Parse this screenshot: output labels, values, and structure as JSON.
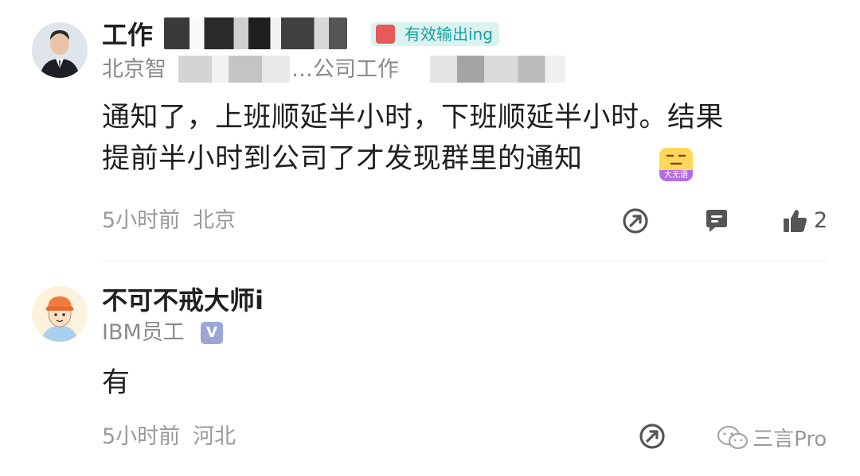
{
  "comments": [
    {
      "user_name": "工作",
      "tag_label": "有效输出ing",
      "subtitle_prefix": "北京智",
      "subtitle_mid": "…公司工作",
      "content_line1": "通知了，上班顺延半小时，下班顺延半小时。结果",
      "content_line2": "提前半小时到公司了才发现群里的通知",
      "emoji_label": "大无语",
      "time": "5小时前",
      "location": "北京",
      "like_count": "2"
    },
    {
      "user_name": "不可不戒大师i",
      "subtitle": "IBM员工",
      "verified_mark": "V",
      "content": "有",
      "time": "5小时前",
      "location": "河北"
    }
  ],
  "watermark": {
    "text": "三言Pro"
  },
  "colors": {
    "text": "#1f1f1f",
    "meta": "#9a9a9a",
    "icon": "#555555",
    "verified": "#9aa6d6",
    "tag_bg": "#daf3f0",
    "tag_text": "#1aa0a0"
  }
}
